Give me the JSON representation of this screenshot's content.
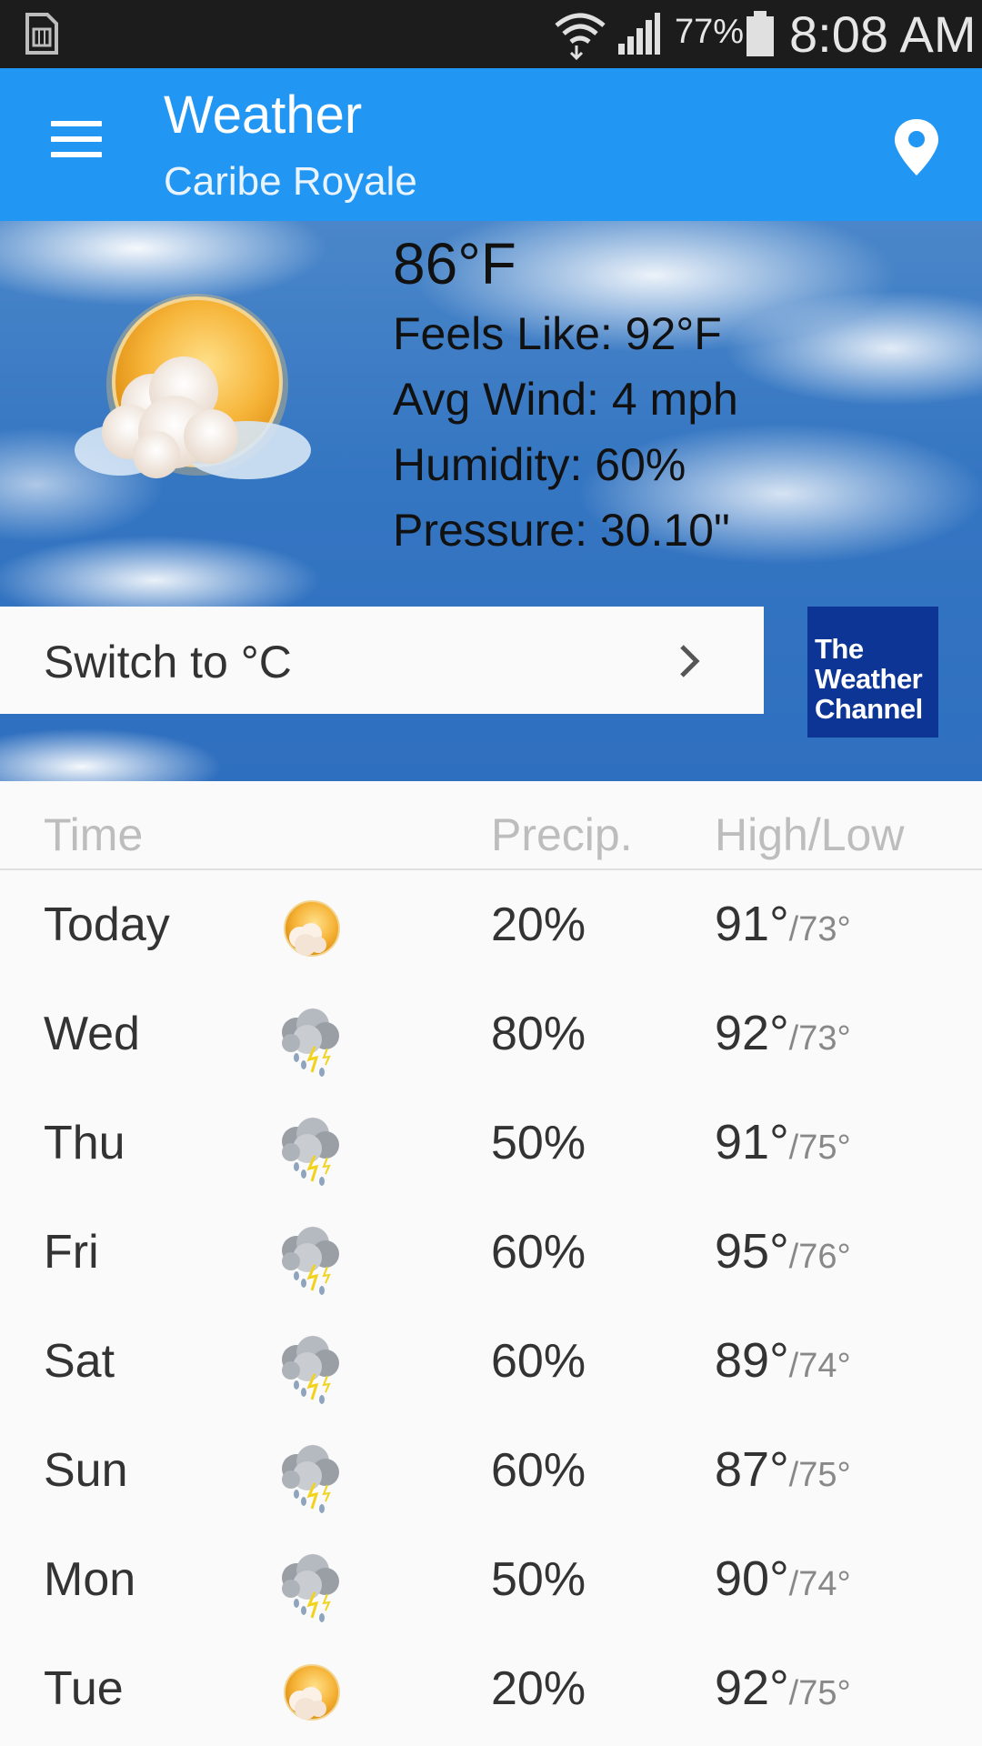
{
  "status_bar": {
    "battery_percent": "77%",
    "clock": "8:08 AM",
    "icons": [
      "sim-card-icon",
      "wifi-icon",
      "signal-icon",
      "battery-icon"
    ]
  },
  "app_bar": {
    "title": "Weather",
    "subtitle": "Caribe Royale",
    "color": "#2196f3",
    "icons": [
      "menu-icon",
      "location-pin-icon"
    ]
  },
  "current": {
    "temperature": "86°F",
    "feels_like": "Feels Like:  92°F",
    "avg_wind": "Avg Wind:  4 mph",
    "humidity": "Humidity:  60%",
    "pressure": "Pressure:  30.10\"",
    "condition_icon": "partly-cloudy-icon"
  },
  "switch_unit": {
    "label": "Switch to °C",
    "icon": "chevron-right-icon"
  },
  "twc_logo": {
    "line1": "The",
    "line2": "Weather",
    "line3": "Channel",
    "color": "#0c3596"
  },
  "forecast": {
    "headers": {
      "time": "Time",
      "precip": "Precip.",
      "high_low": "High/Low"
    },
    "rows": [
      {
        "day": "Today",
        "icon": "partly-cloudy-icon",
        "precip": "20%",
        "high": "91°",
        "low": "/73°"
      },
      {
        "day": "Wed",
        "icon": "thunderstorm-icon",
        "precip": "80%",
        "high": "92°",
        "low": "/73°"
      },
      {
        "day": "Thu",
        "icon": "thunderstorm-icon",
        "precip": "50%",
        "high": "91°",
        "low": "/75°"
      },
      {
        "day": "Fri",
        "icon": "thunderstorm-icon",
        "precip": "60%",
        "high": "95°",
        "low": "/76°"
      },
      {
        "day": "Sat",
        "icon": "thunderstorm-icon",
        "precip": "60%",
        "high": "89°",
        "low": "/74°"
      },
      {
        "day": "Sun",
        "icon": "thunderstorm-icon",
        "precip": "60%",
        "high": "87°",
        "low": "/75°"
      },
      {
        "day": "Mon",
        "icon": "thunderstorm-icon",
        "precip": "50%",
        "high": "90°",
        "low": "/74°"
      },
      {
        "day": "Tue",
        "icon": "partly-cloudy-icon",
        "precip": "20%",
        "high": "92°",
        "low": "/75°"
      }
    ]
  }
}
